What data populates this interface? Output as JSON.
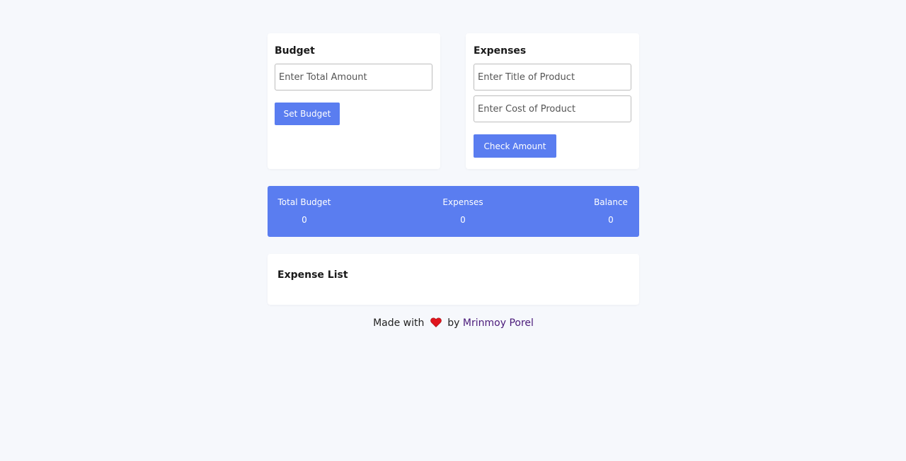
{
  "budget": {
    "title": "Budget",
    "amount_placeholder": "Enter Total Amount",
    "amount_value": "",
    "button_label": "Set Budget"
  },
  "expenses": {
    "title": "Expenses",
    "title_placeholder": "Enter Title of Product",
    "title_value": "",
    "cost_placeholder": "Enter Cost of Product",
    "cost_value": "",
    "button_label": "Check Amount"
  },
  "summary": {
    "total_budget_label": "Total Budget",
    "total_budget_value": "0",
    "expenses_label": "Expenses",
    "expenses_value": "0",
    "balance_label": "Balance",
    "balance_value": "0"
  },
  "expense_list": {
    "title": "Expense List",
    "items": []
  },
  "footer": {
    "prefix": "Made with",
    "heart_icon": "heart-icon",
    "middle": "by",
    "author": "Mrinmoy Porel"
  },
  "colors": {
    "accent": "#5a7df0",
    "background": "#f6f8fc",
    "heart": "#e0151d",
    "author_link": "#4a1a7a"
  }
}
